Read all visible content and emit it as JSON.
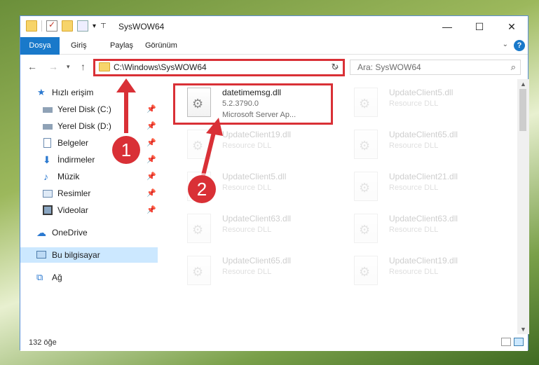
{
  "window": {
    "title": "SysWOW64"
  },
  "ribbon": {
    "tabs": [
      {
        "label": "Dosya"
      },
      {
        "label": "Giriş"
      },
      {
        "label": "Paylaş"
      },
      {
        "label": "Görünüm"
      }
    ],
    "help_label": "?"
  },
  "address": {
    "path": "C:\\Windows\\SysWOW64"
  },
  "search": {
    "placeholder": "Ara: SysWOW64"
  },
  "sidebar": {
    "items": [
      {
        "label": "Hızlı erişim",
        "icon": "star-icon"
      },
      {
        "label": "Yerel Disk (C:)",
        "icon": "drive-icon",
        "pinned": true
      },
      {
        "label": "Yerel Disk (D:)",
        "icon": "drive-icon",
        "pinned": true
      },
      {
        "label": "Belgeler",
        "icon": "document-icon",
        "pinned": true
      },
      {
        "label": "İndirmeler",
        "icon": "download-icon",
        "pinned": true
      },
      {
        "label": "Müzik",
        "icon": "music-icon",
        "pinned": true
      },
      {
        "label": "Resimler",
        "icon": "picture-icon",
        "pinned": true
      },
      {
        "label": "Videolar",
        "icon": "video-icon",
        "pinned": true
      },
      {
        "label": "OneDrive",
        "icon": "cloud-icon"
      },
      {
        "label": "Bu bilgisayar",
        "icon": "computer-icon",
        "selected": true
      },
      {
        "label": "Ağ",
        "icon": "network-icon"
      }
    ]
  },
  "files": [
    {
      "name": "datetimemsg.dll",
      "line2": "5.2.3790.0",
      "line3": "Microsoft Server Ap...",
      "highlighted": true
    },
    {
      "name": "UpdateClient5.dll",
      "line2": "Resource DLL"
    },
    {
      "name": "UpdateClient19.dll",
      "line2": "Resource DLL"
    },
    {
      "name": "UpdateClient65.dll",
      "line2": "Resource DLL"
    },
    {
      "name": "UpdateClient5.dll",
      "line2": "Resource DLL"
    },
    {
      "name": "UpdateClient21.dll",
      "line2": "Resource DLL"
    },
    {
      "name": "UpdateClient63.dll",
      "line2": "Resource DLL"
    },
    {
      "name": "UpdateClient63.dll",
      "line2": "Resource DLL"
    },
    {
      "name": "UpdateClient65.dll",
      "line2": "Resource DLL"
    },
    {
      "name": "UpdateClient19.dll",
      "line2": "Resource DLL"
    }
  ],
  "status": {
    "count_text": "132 öğe"
  },
  "callouts": {
    "one": "1",
    "two": "2"
  },
  "colors": {
    "accent": "#1979ca",
    "highlight_red": "#d93036",
    "selected_bg": "#cce8ff"
  }
}
